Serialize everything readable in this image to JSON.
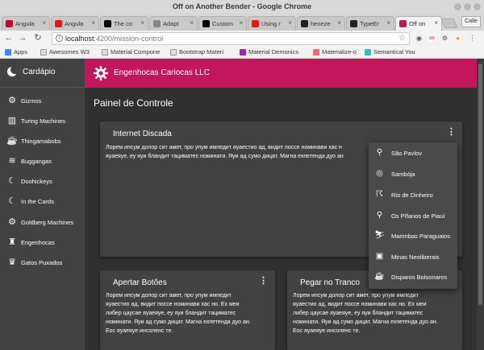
{
  "window": {
    "title": "Off on Another Bender - Google Chrome"
  },
  "tabs": [
    {
      "label": "Angula",
      "favicon_color": "#c3002f"
    },
    {
      "label": "Angula",
      "favicon_color": "#dd1b16"
    },
    {
      "label": "The co",
      "favicon_color": "#000000"
    },
    {
      "label": "Adapt",
      "favicon_color": "#888888"
    },
    {
      "label": "Custom",
      "favicon_color": "#000000"
    },
    {
      "label": "Using r",
      "favicon_color": "#dd1b16"
    },
    {
      "label": "heneze",
      "favicon_color": "#222222"
    },
    {
      "label": "TypeEr",
      "favicon_color": "#222222"
    },
    {
      "label": "Off on",
      "favicon_color": "#c2185b"
    }
  ],
  "profile_label": "Calle",
  "address_bar": {
    "url_host": "localhost",
    "url_rest": ":4200/mission-control"
  },
  "bookmarks": [
    {
      "label": "Apps",
      "icon_color": "#4285f4"
    },
    {
      "label": "Awesomes W3",
      "icon_color": "#cccccc"
    },
    {
      "label": "Material Compone",
      "icon_color": "#cccccc"
    },
    {
      "label": "Bootstrap Materi",
      "icon_color": "#cccccc"
    },
    {
      "label": "Material Demonics",
      "icon_color": "#9c27b0"
    },
    {
      "label": "Materialize-o",
      "icon_color": "#ee6e73"
    },
    {
      "label": "Semantical You",
      "icon_color": "#35bdb2"
    }
  ],
  "sidebar": {
    "title": "Cardápio",
    "items": [
      {
        "label": "Gizmos",
        "icon": "gear-icon",
        "glyph": "⚙"
      },
      {
        "label": "Turing Machines",
        "icon": "machine-icon",
        "glyph": "▥"
      },
      {
        "label": "Thingamabobs",
        "icon": "coffee-icon",
        "glyph": "☕"
      },
      {
        "label": "Buggangas",
        "icon": "waves-icon",
        "glyph": "≋"
      },
      {
        "label": "Doohickeys",
        "icon": "moon-icon",
        "glyph": "☾"
      },
      {
        "label": "In the Cards",
        "icon": "moon-icon",
        "glyph": "☾"
      },
      {
        "label": "Goldberg Machines",
        "icon": "gear-icon",
        "glyph": "⚙"
      },
      {
        "label": "Engenhocas",
        "icon": "chess-rook-icon",
        "glyph": "♜"
      },
      {
        "label": "Gatos Puxados",
        "icon": "crown-icon",
        "glyph": "♛"
      }
    ]
  },
  "appbar": {
    "title": "Engenhocas Cariocas LLC"
  },
  "page": {
    "title": "Painel de Controle"
  },
  "cards": {
    "internet": {
      "title": "Internet Discada",
      "body": [
        "Лорем ипсум долор сит амет, про уnум импедит яуаестио ад, видит поссе номинави хас н",
        "яуаеяуе, еу яуи бландит тациматес номинати. Яуи ад сумо дицат. Магна ехпетенда дуо ан"
      ]
    },
    "apertar": {
      "title": "Apertar Botões",
      "body": [
        "Лорем ипсум долор сит амет, про уnум импедит",
        "яуаестио ад, видит поссе номинави хас но. Ех меи",
        "либер цаусае яуаеяуе, еу яуи бландит тациматес",
        "номинати. Яуи ад сумо дицат. Магна ехпетенда дуо ан.",
        "Еос яуаеяуе инсоленс те."
      ]
    },
    "tranco": {
      "title": "Pegar no Tranco",
      "body": [
        "Лорем ипсум долор сит амет, про уnум импедит",
        "яуаестио ад, видит поссе номинави хас но. Ех меи",
        "либер цаусае яуаеяуе, еу яуи бландит тациматес",
        "номинати. Яуи ад сумо дицат. Магна ехпетенда дуо ан.",
        "Еос яуаеяуе инсоленс те."
      ]
    }
  },
  "menu": [
    {
      "label": "São Pavlov",
      "icon": "bike-icon",
      "glyph": "⚲"
    },
    {
      "label": "Sambója",
      "icon": "target-icon",
      "glyph": "◎"
    },
    {
      "label": "Rio de Dinheiro",
      "icon": "runner-icon",
      "glyph": "☈"
    },
    {
      "label": "Os Pífanos de Piauí",
      "icon": "map-pin-icon",
      "glyph": "⚲"
    },
    {
      "label": "Marimbas Paraguaios",
      "icon": "sled-icon",
      "glyph": "⛷"
    },
    {
      "label": "Minas Neoliberais",
      "icon": "bus-icon",
      "glyph": "▣"
    },
    {
      "label": "Disparos Bolsonaros",
      "icon": "coffee-icon",
      "glyph": "☕"
    }
  ]
}
